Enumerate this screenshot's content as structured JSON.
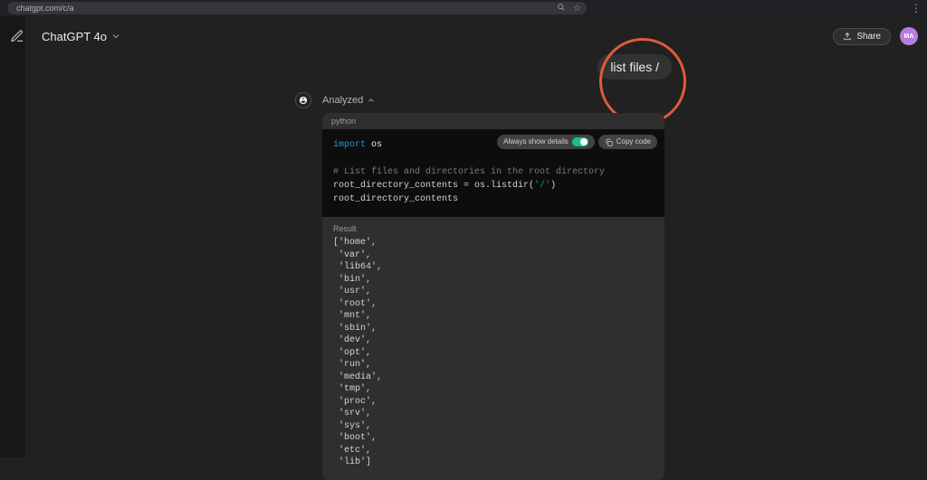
{
  "browser": {
    "url": "chatgpt.com/c/a"
  },
  "header": {
    "model": "ChatGPT 4o",
    "share": "Share",
    "avatar_initials": "MA"
  },
  "conversation": {
    "user_message": "list files /",
    "analyzed_label": "Analyzed"
  },
  "code": {
    "language": "python",
    "always_show": "Always show details",
    "copy": "Copy code",
    "line1_import": "import",
    "line1_os": "os",
    "line2_comment": "# List files and directories in the root directory",
    "line3a": "root_directory_contents = os.listdir(",
    "line3b": "'/'",
    "line3c": ")",
    "line4": "root_directory_contents"
  },
  "result": {
    "label": "Result",
    "items": [
      "home",
      "var",
      "lib64",
      "bin",
      "usr",
      "root",
      "mnt",
      "sbin",
      "dev",
      "opt",
      "run",
      "media",
      "tmp",
      "proc",
      "srv",
      "sys",
      "boot",
      "etc",
      "lib"
    ]
  }
}
